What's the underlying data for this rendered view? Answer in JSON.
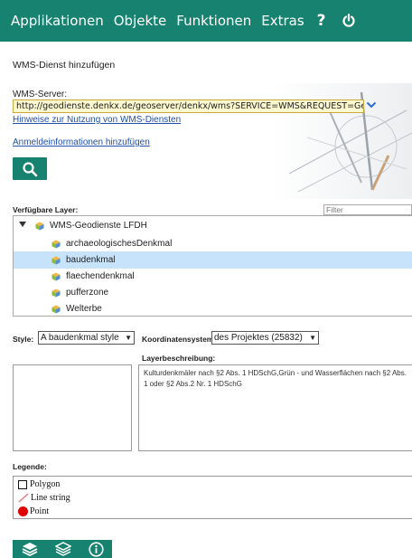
{
  "menu": {
    "items": [
      "Applikationen",
      "Objekte",
      "Funktionen",
      "Extras"
    ],
    "help_symbol": "?",
    "icons": [
      "help-icon",
      "power-icon"
    ]
  },
  "dialog": {
    "title": "WMS-Dienst hinzufügen",
    "server_label": "WMS-Server:",
    "server_url": "http://geodienste.denkx.de/geoserver/denkx/wms?SERVICE=WMS&REQUEST=GetCapabilities",
    "hint_link": "Hinweise zur Nutzung von WMS-Diensten",
    "credentials_link": "Anmeldeinformationen hinzufügen",
    "search_icon": "search-icon"
  },
  "layers": {
    "label": "Verfügbare Layer:",
    "filter_placeholder": "Filter",
    "root": "WMS-Geodienste LFDH",
    "items": [
      "archaeologischesDenkmal",
      "baudenkmal",
      "flaechendenkmal",
      "pufferzone",
      "Welterbe"
    ],
    "selected_index": 1
  },
  "style": {
    "label": "Style:",
    "value": "A baudenkmal style"
  },
  "crs": {
    "label": "Koordinatensystem:",
    "value": "des Projektes (25832)"
  },
  "description": {
    "label": "Layerbeschreibung:",
    "text": "Kulturdenkmäler nach §2 Abs. 1 HDSchG,Grün - und Wasserflächen nach §2 Abs. 1 oder §2 Abs.2 Nr. 1 HDSchG"
  },
  "legend": {
    "label": "Legende:",
    "items": [
      "Polygon",
      "Line string",
      "Point"
    ]
  },
  "bottom_toolbar": {
    "icons": [
      "layers-add-icon",
      "layers-icon",
      "info-icon"
    ]
  },
  "colors": {
    "accent": "#17826f",
    "selected_row": "#c7e3fb",
    "point": "#e00000",
    "line": "#e87b7b",
    "input_bg": "#fbf7cf"
  }
}
